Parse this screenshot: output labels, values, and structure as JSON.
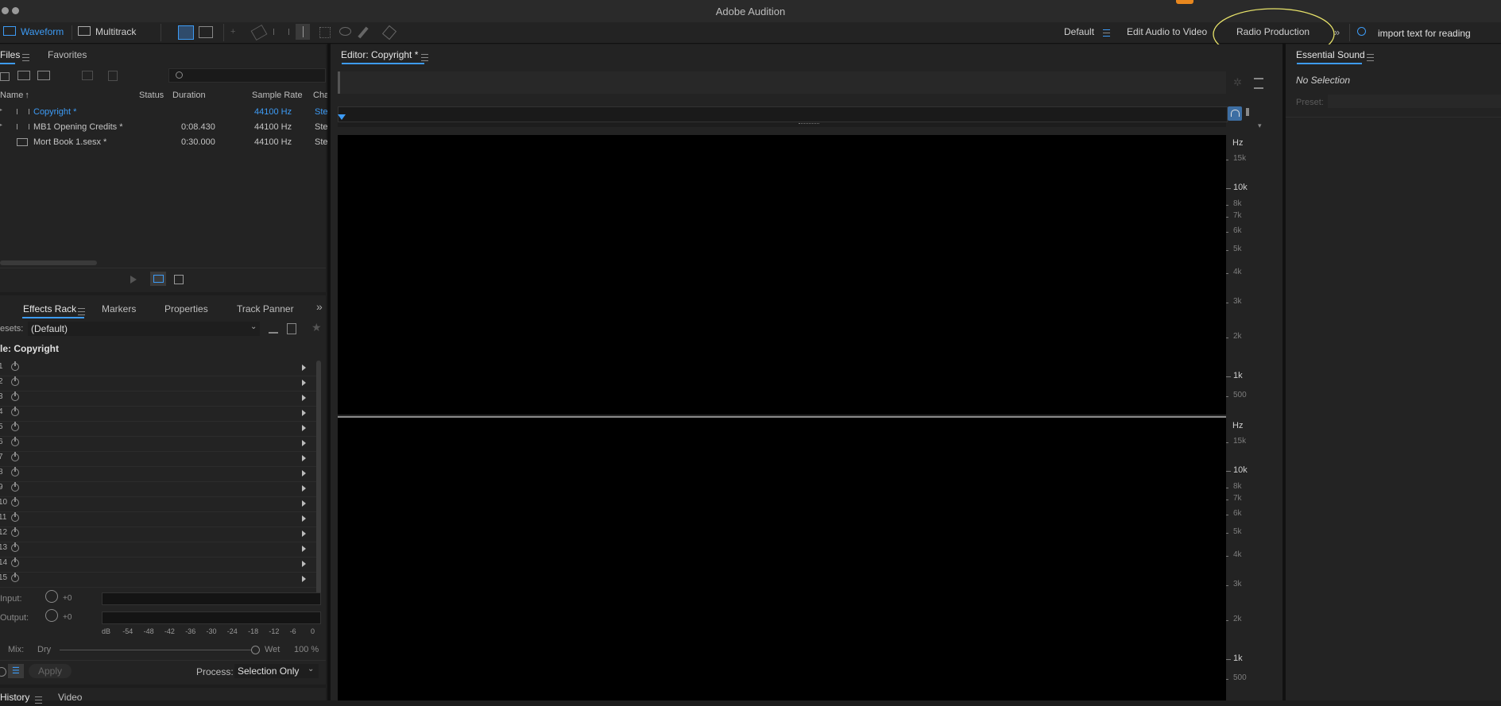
{
  "app": {
    "title": "Adobe Audition"
  },
  "toolbar": {
    "waveform_label": "Waveform",
    "multitrack_label": "Multitrack",
    "workspaces": [
      "Default",
      "Edit Audio to Video",
      "Radio Production"
    ],
    "search_value": "import text for reading"
  },
  "files_panel": {
    "tabs": [
      "Files",
      "Favorites"
    ],
    "columns": [
      "Name",
      "Status",
      "Duration",
      "Sample Rate",
      "Cha"
    ],
    "rows": [
      {
        "name": "Copyright *",
        "status": "",
        "duration": "",
        "sample_rate": "44100 Hz",
        "channels": "Ste"
      },
      {
        "name": "MB1 Opening Credits *",
        "status": "",
        "duration": "0:08.430",
        "sample_rate": "44100 Hz",
        "channels": "Ste"
      },
      {
        "name": "Mort Book 1.sesx *",
        "status": "",
        "duration": "0:30.000",
        "sample_rate": "44100 Hz",
        "channels": "Ste"
      }
    ]
  },
  "effects_panel": {
    "tabs": [
      "Effects Rack",
      "Markers",
      "Properties",
      "Track Panner"
    ],
    "presets_label": "esets:",
    "presets_value": "(Default)",
    "file_label": "le: Copyright",
    "slots": [
      "1",
      "2",
      "3",
      "4",
      "5",
      "6",
      "7",
      "8",
      "9",
      "10",
      "11",
      "12",
      "13",
      "14",
      "15"
    ],
    "input_label": "Input:",
    "output_label": "Output:",
    "input_gain": "+0",
    "output_gain": "+0",
    "meter_scale": [
      "dB",
      "-54",
      "-48",
      "-42",
      "-36",
      "-30",
      "-24",
      "-18",
      "-12",
      "-6",
      "0"
    ],
    "mix_label": "Mix:",
    "dry_label": "Dry",
    "wet_label": "Wet",
    "wet_value": "100 %",
    "apply_label": "Apply",
    "process_label": "Process:",
    "process_value": "Selection Only"
  },
  "bottom_tabs": [
    "History",
    "Video"
  ],
  "editor": {
    "title": "Editor: Copyright *",
    "hz_unit": "Hz",
    "freq_labels": [
      "15k",
      "10k",
      "8k",
      "7k",
      "6k",
      "5k",
      "4k",
      "3k",
      "2k",
      "1k",
      "500"
    ]
  },
  "essential_sound": {
    "title": "Essential Sound",
    "selection": "No Selection",
    "preset_label": "Preset:"
  },
  "colors": {
    "accent": "#3d9bf5",
    "annotation": "#e8e36a"
  }
}
